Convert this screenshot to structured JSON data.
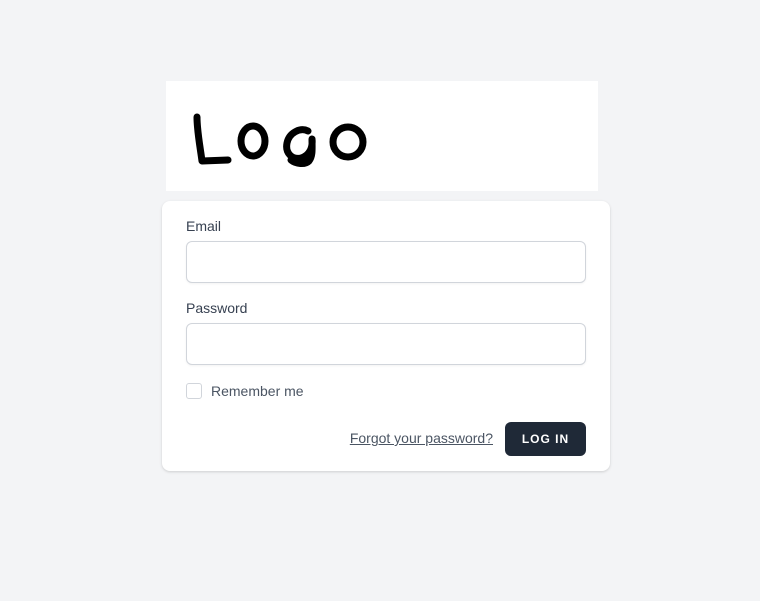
{
  "logo": {
    "text": "Logo"
  },
  "form": {
    "email_label": "Email",
    "email_value": "",
    "password_label": "Password",
    "password_value": "",
    "remember_label": "Remember me",
    "remember_checked": false,
    "forgot_link": "Forgot your password?",
    "login_button": "LOG IN"
  },
  "colors": {
    "page_background": "#f3f4f6",
    "card_background": "#ffffff",
    "button_background": "#1f2937",
    "button_text": "#ffffff",
    "label_text": "#374151",
    "input_border": "#d1d5db"
  }
}
